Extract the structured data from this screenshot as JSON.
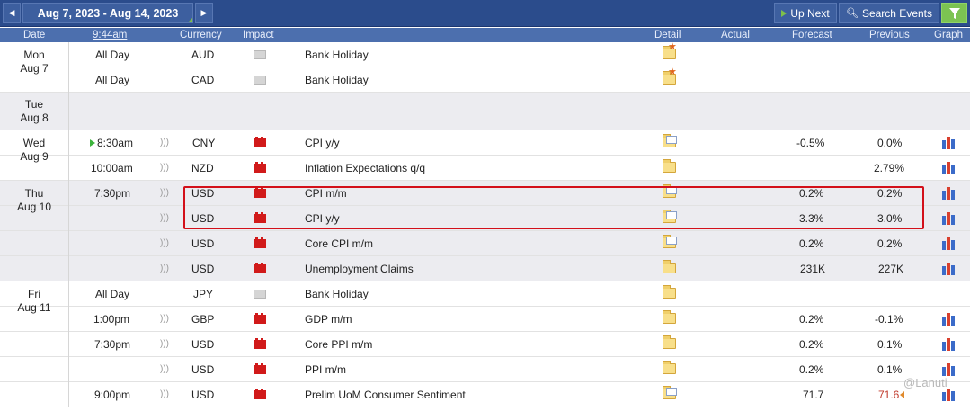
{
  "toolbar": {
    "prev_icon": "prev-week-icon",
    "date_range": "Aug 7, 2023 - Aug 14, 2023",
    "next_icon": "next-week-icon",
    "up_next": "Up Next",
    "search_events": "Search Events",
    "filter_icon": "filter-icon"
  },
  "columns": {
    "date": "Date",
    "time": "9:44am",
    "currency": "Currency",
    "impact": "Impact",
    "detail": "Detail",
    "actual": "Actual",
    "forecast": "Forecast",
    "previous": "Previous",
    "graph": "Graph"
  },
  "days": [
    {
      "day": "Mon",
      "date": "Aug 7"
    },
    {
      "day": "Tue",
      "date": "Aug 8"
    },
    {
      "day": "Wed",
      "date": "Aug 9"
    },
    {
      "day": "Thu",
      "date": "Aug 10"
    },
    {
      "day": "Fri",
      "date": "Aug 11"
    }
  ],
  "events": [
    {
      "time": "All Day",
      "currency": "AUD",
      "impact": "holiday",
      "event": "Bank Holiday",
      "detail": "star",
      "actual": "",
      "forecast": "",
      "previous": "",
      "graph": false
    },
    {
      "time": "All Day",
      "currency": "CAD",
      "impact": "holiday",
      "event": "Bank Holiday",
      "detail": "star",
      "actual": "",
      "forecast": "",
      "previous": "",
      "graph": false
    },
    {
      "time": "",
      "currency": "",
      "impact": "",
      "event": "",
      "detail": "",
      "actual": "",
      "forecast": "",
      "previous": "",
      "graph": false
    },
    {
      "time": "8:30am",
      "currency": "CNY",
      "impact": "high",
      "event": "CPI y/y",
      "detail": "doc",
      "actual": "",
      "forecast": "-0.5%",
      "previous": "0.0%",
      "graph": true
    },
    {
      "time": "10:00am",
      "currency": "NZD",
      "impact": "high",
      "event": "Inflation Expectations q/q",
      "detail": "folder",
      "actual": "",
      "forecast": "",
      "previous": "2.79%",
      "graph": true
    },
    {
      "time": "7:30pm",
      "currency": "USD",
      "impact": "high",
      "event": "CPI m/m",
      "detail": "doc",
      "actual": "",
      "forecast": "0.2%",
      "previous": "0.2%",
      "graph": true
    },
    {
      "time": "",
      "currency": "USD",
      "impact": "high",
      "event": "CPI y/y",
      "detail": "doc",
      "actual": "",
      "forecast": "3.3%",
      "previous": "3.0%",
      "graph": true
    },
    {
      "time": "",
      "currency": "USD",
      "impact": "high",
      "event": "Core CPI m/m",
      "detail": "doc",
      "actual": "",
      "forecast": "0.2%",
      "previous": "0.2%",
      "graph": true
    },
    {
      "time": "",
      "currency": "USD",
      "impact": "high",
      "event": "Unemployment Claims",
      "detail": "folder",
      "actual": "",
      "forecast": "231K",
      "previous": "227K",
      "graph": true
    },
    {
      "time": "All Day",
      "currency": "JPY",
      "impact": "holiday",
      "event": "Bank Holiday",
      "detail": "folder",
      "actual": "",
      "forecast": "",
      "previous": "",
      "graph": false
    },
    {
      "time": "1:00pm",
      "currency": "GBP",
      "impact": "high",
      "event": "GDP m/m",
      "detail": "folder",
      "actual": "",
      "forecast": "0.2%",
      "previous": "-0.1%",
      "graph": true
    },
    {
      "time": "7:30pm",
      "currency": "USD",
      "impact": "high",
      "event": "Core PPI m/m",
      "detail": "folder",
      "actual": "",
      "forecast": "0.2%",
      "previous": "0.1%",
      "graph": true
    },
    {
      "time": "",
      "currency": "USD",
      "impact": "high",
      "event": "PPI m/m",
      "detail": "folder",
      "actual": "",
      "forecast": "0.2%",
      "previous": "0.1%",
      "graph": true
    },
    {
      "time": "9:00pm",
      "currency": "USD",
      "impact": "high",
      "event": "Prelim UoM Consumer Sentiment",
      "detail": "doc",
      "actual": "",
      "forecast": "71.7",
      "previous": "71.6",
      "graph": true
    }
  ],
  "colors": {
    "topbar": "#2b4c8c",
    "header": "#4c6fae",
    "high_impact": "#d11a1a",
    "highlight_box": "#d3101a",
    "previous_revised": "#c0392b"
  },
  "watermark": "@Lanuti"
}
